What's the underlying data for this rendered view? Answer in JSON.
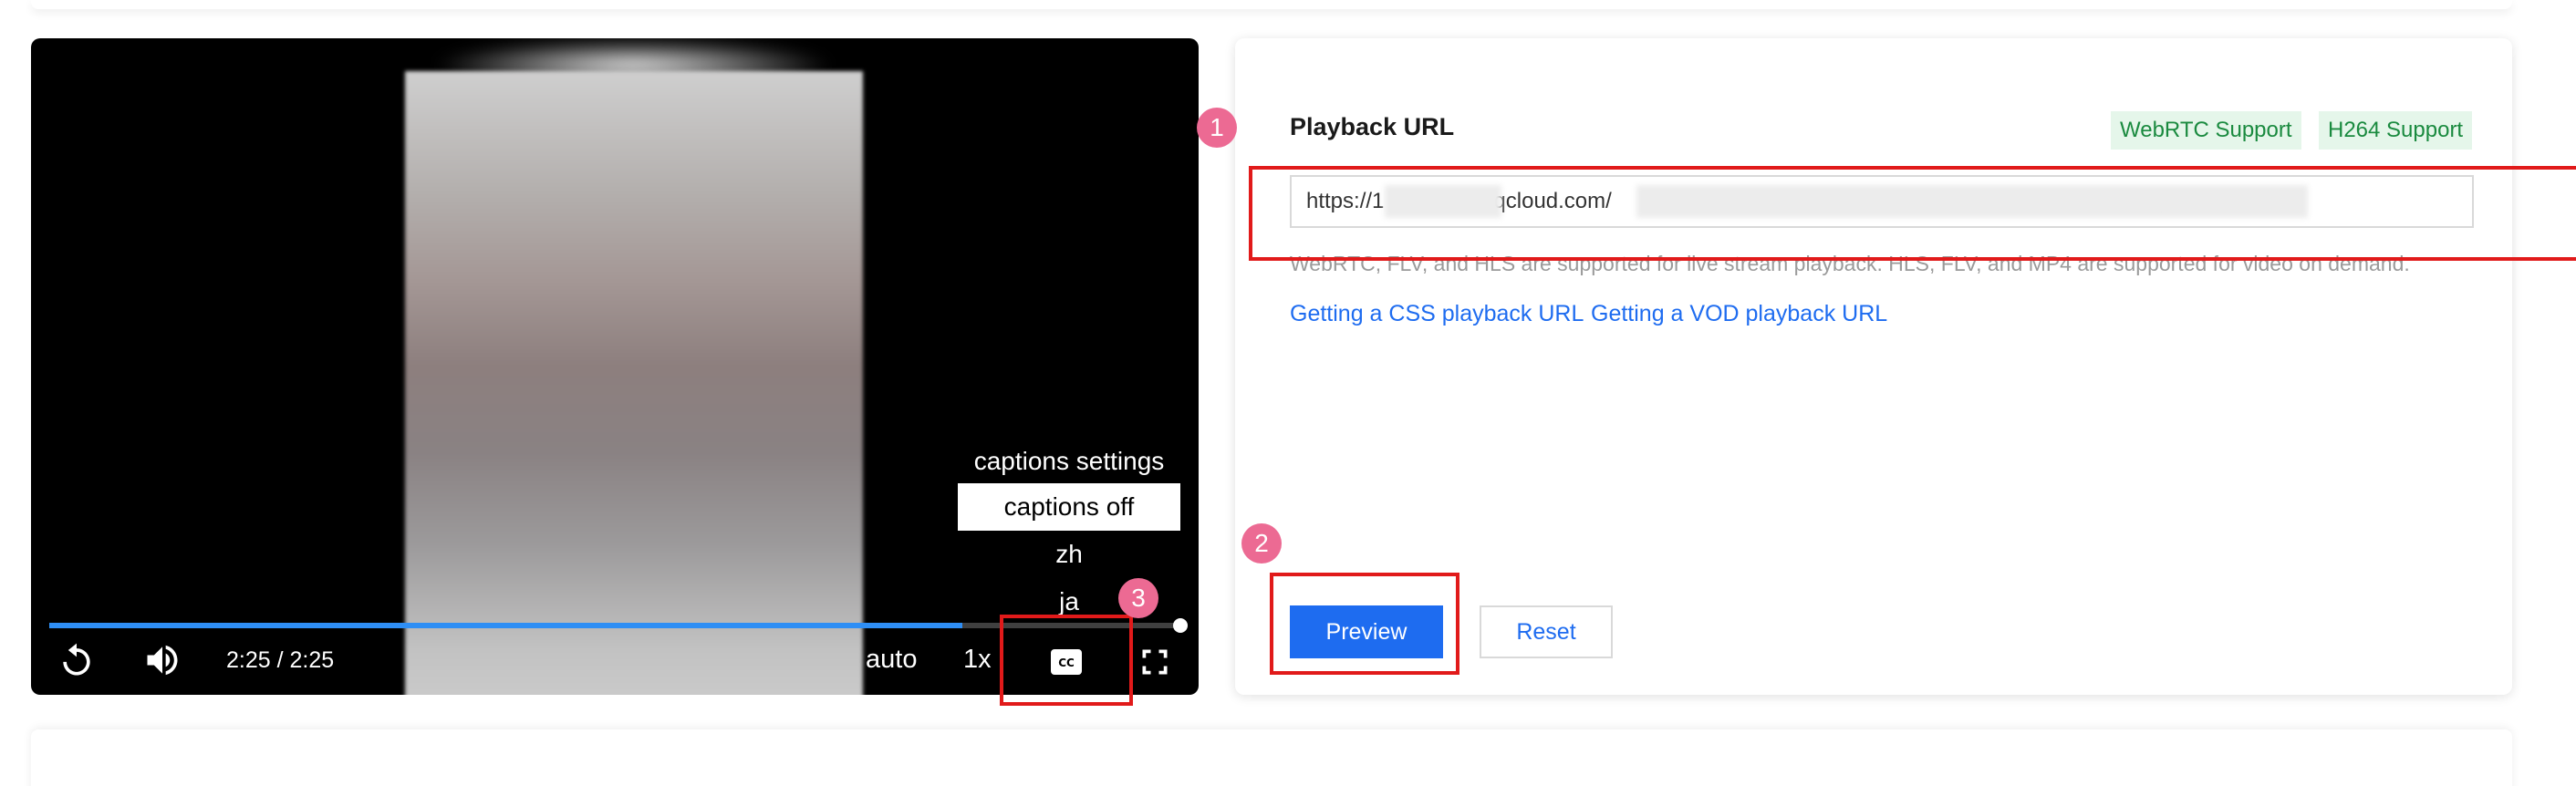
{
  "player": {
    "captions_menu": {
      "title": "captions settings",
      "items": [
        "captions off",
        "zh",
        "ja"
      ],
      "selected": "captions off"
    },
    "time_display": "2:25 / 2:25",
    "progress": 0.81,
    "quality_label": "auto",
    "speed_label": "1x",
    "cc_label": "CC"
  },
  "config": {
    "title": "Playback URL",
    "tags": [
      "WebRTC Support",
      "H264 Support"
    ],
    "url_value": "https://1          .vod-qcloud.com/                                                                                 35/adp.10.m3u8",
    "hint": "WebRTC, FLV, and HLS are supported for live stream playback. HLS, FLV, and MP4 are supported for video on demand.",
    "links": [
      "Getting a CSS playback URL",
      "Getting a VOD playback URL"
    ],
    "preview_label": "Preview",
    "reset_label": "Reset"
  },
  "annotations": {
    "step1": "1",
    "step2": "2",
    "step3": "3"
  },
  "colors": {
    "accent": "#1e6cf0",
    "tag_bg": "#e5f6ea",
    "tag_text": "#1a8a3f",
    "annotation_red": "#e11a1a",
    "badge_pink": "#ec6a93",
    "progress_blue": "#2e8ef5"
  }
}
